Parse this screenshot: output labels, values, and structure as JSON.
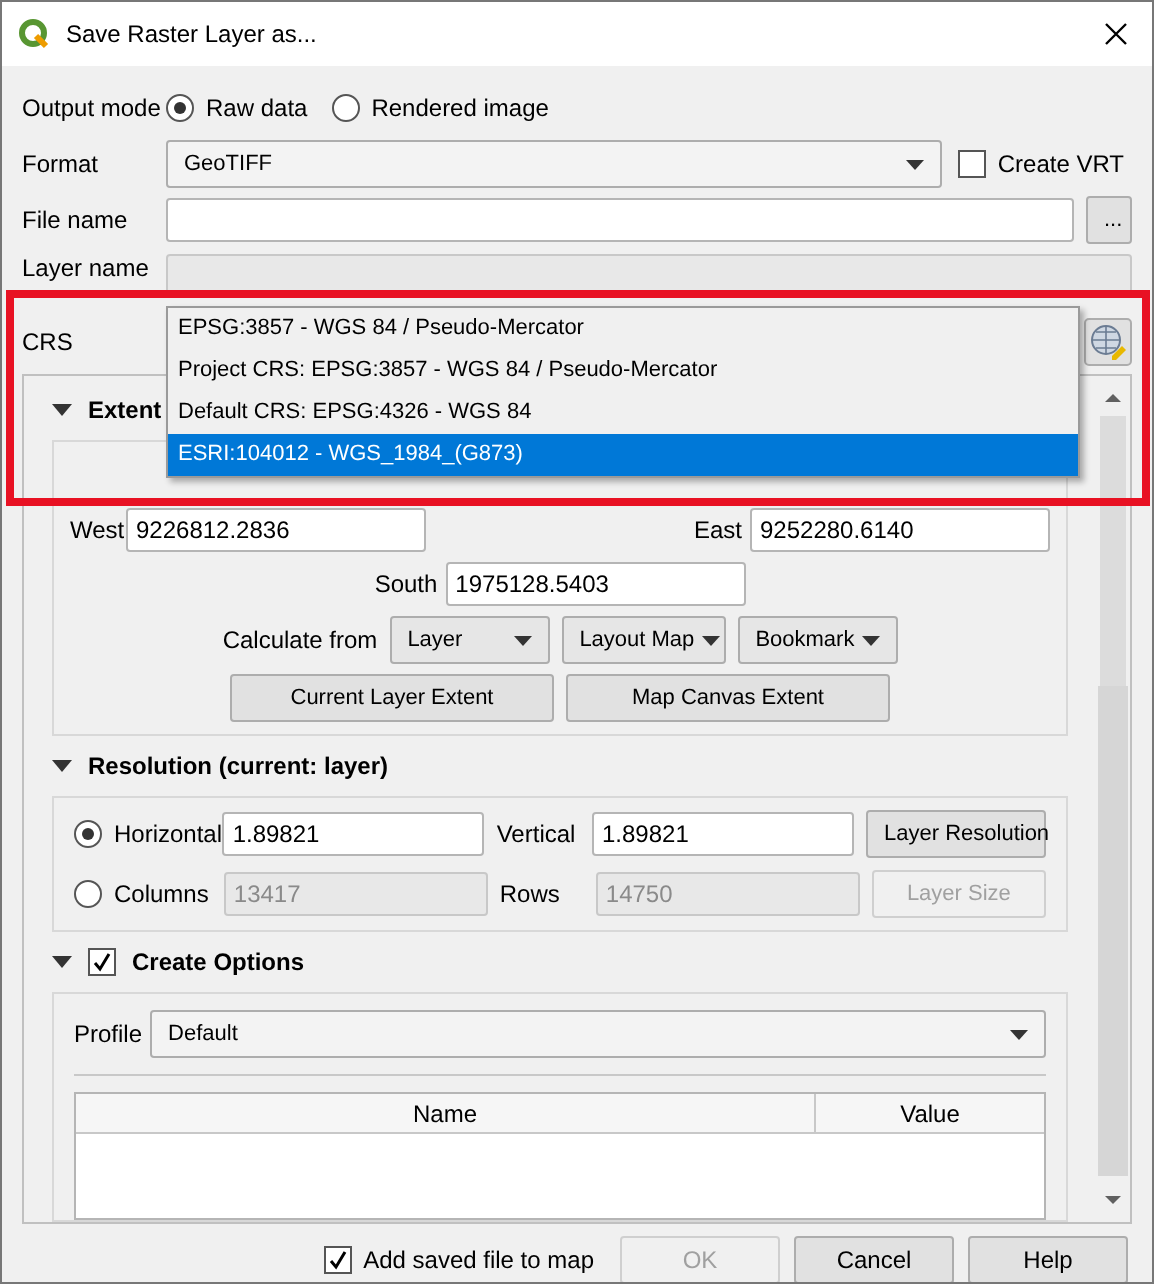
{
  "window": {
    "title": "Save Raster Layer as..."
  },
  "output_mode": {
    "label": "Output mode",
    "options": [
      {
        "label": "Raw data",
        "selected": true
      },
      {
        "label": "Rendered image",
        "selected": false
      }
    ]
  },
  "format": {
    "label": "Format",
    "value": "GeoTIFF"
  },
  "create_vrt": {
    "label": "Create VRT",
    "checked": false
  },
  "file_name": {
    "label": "File name",
    "browse": "..."
  },
  "layer_name": {
    "label": "Layer name"
  },
  "crs": {
    "label": "CRS",
    "options": [
      {
        "label": "EPSG:3857 - WGS 84 / Pseudo-Mercator",
        "selected": false
      },
      {
        "label": "Project CRS: EPSG:3857 - WGS 84 / Pseudo-Mercator",
        "selected": false
      },
      {
        "label": "Default CRS: EPSG:4326 - WGS 84",
        "selected": false
      },
      {
        "label": "ESRI:104012 - WGS_1984_(G873)",
        "selected": true
      }
    ]
  },
  "extent": {
    "title": "Extent",
    "expanded": true,
    "west": {
      "label": "West",
      "value": "9226812.2836"
    },
    "east": {
      "label": "East",
      "value": "9252280.6140"
    },
    "south": {
      "label": "South",
      "value": "1975128.5403"
    },
    "calculate_from": "Calculate from",
    "dropdowns": [
      "Layer",
      "Layout Map",
      "Bookmark"
    ],
    "buttons": [
      "Current Layer Extent",
      "Map Canvas Extent"
    ]
  },
  "resolution": {
    "title": "Resolution (current: layer)",
    "expanded": true,
    "modes": [
      {
        "label": "Horizontal",
        "selected": true,
        "value": "1.89821",
        "label2": "Vertical",
        "value2": "1.89821",
        "button": "Layer Resolution"
      },
      {
        "label": "Columns",
        "selected": false,
        "value": "13417",
        "label2": "Rows",
        "value2": "14750",
        "button": "Layer Size"
      }
    ]
  },
  "create_options": {
    "title": "Create Options",
    "expanded": true,
    "checked": true,
    "profile": {
      "label": "Profile",
      "value": "Default"
    },
    "columns": [
      "Name",
      "Value"
    ]
  },
  "add_to_map": {
    "label": "Add saved file to map",
    "checked": true
  },
  "buttons": [
    {
      "label": "OK",
      "disabled": true
    },
    {
      "label": "Cancel",
      "disabled": false
    },
    {
      "label": "Help",
      "disabled": false
    }
  ]
}
